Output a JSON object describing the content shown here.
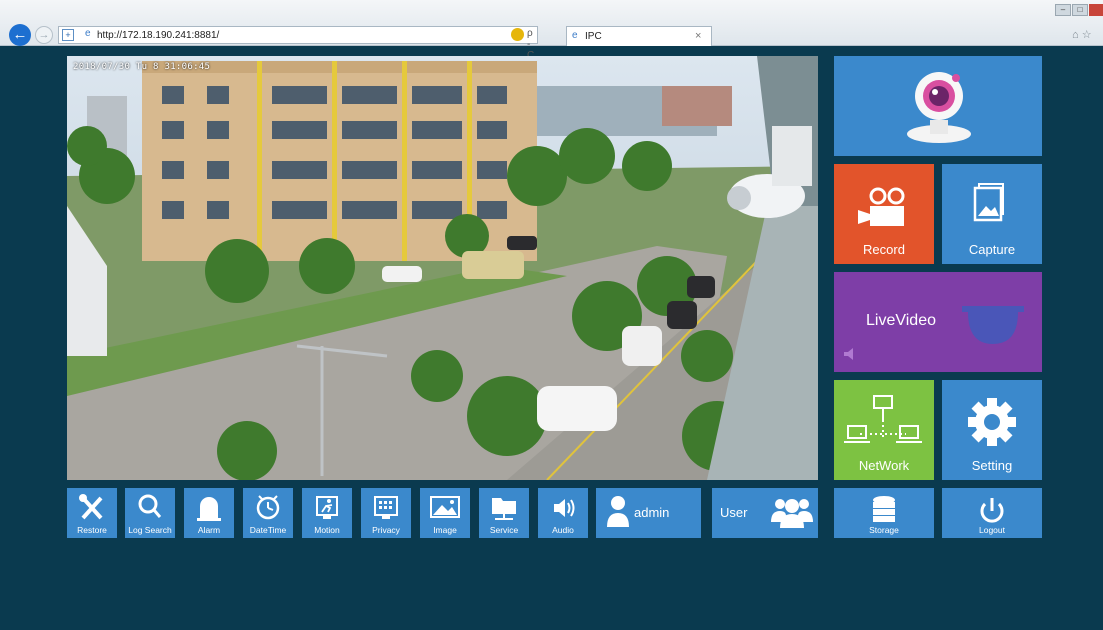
{
  "browser": {
    "url": "http://172.18.190.241:8881/",
    "tab_title": "IPC",
    "tab_close": "×",
    "back": "←",
    "forward": "→",
    "search": "ρ - C",
    "win_min": "–",
    "win_max": "□",
    "home": "⌂ ☆"
  },
  "video": {
    "osd": "2018/07/30 Tu 8 31:06:45"
  },
  "tiles": {
    "record": "Record",
    "capture": "Capture",
    "live": "LiveVideo",
    "network": "NetWork",
    "setting": "Setting",
    "storage": "Storage",
    "logout": "Logout"
  },
  "toolbar": {
    "restore": "Restore",
    "log_search": "Log Search",
    "alarm": "Alarm",
    "datetime": "DateTime",
    "motion": "Motion",
    "privacy": "Privacy",
    "image": "Image",
    "service": "Service",
    "audio": "Audio",
    "user_name": "admin",
    "user": "User"
  },
  "colors": {
    "background": "#0a3a4f",
    "tile_blue": "#3b89cc",
    "record": "#e2542b",
    "live": "#7e3ea7",
    "network": "#7dc242"
  }
}
